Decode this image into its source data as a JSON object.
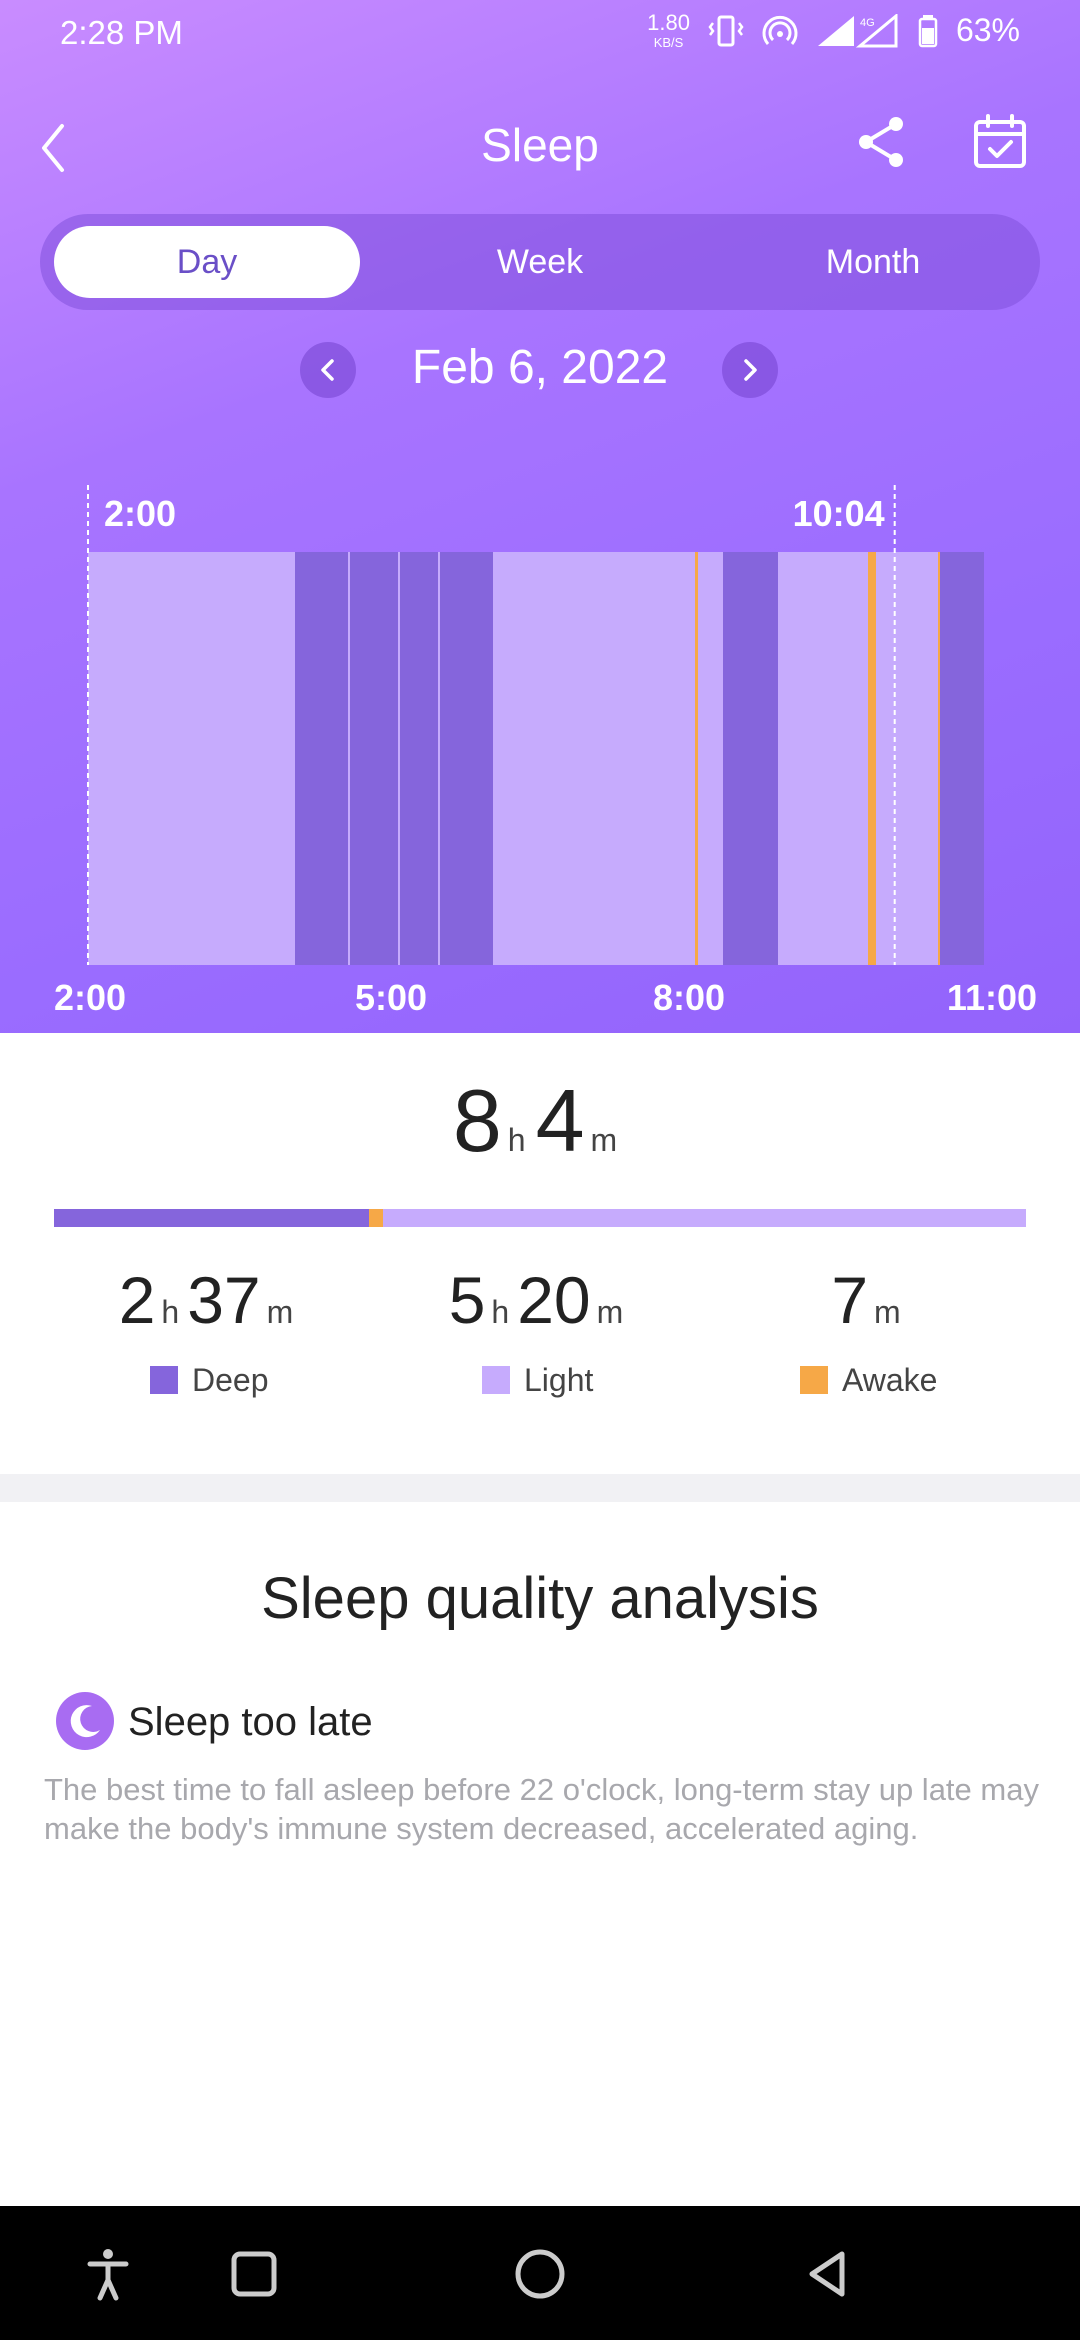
{
  "status_bar": {
    "time": "2:28 PM",
    "net_speed": "1.80",
    "net_unit": "KB/S",
    "network": "4G",
    "battery": "63%"
  },
  "header": {
    "title": "Sleep",
    "icons": [
      "back-arrow-icon",
      "share-icon",
      "calendar-check-icon"
    ]
  },
  "tabs": [
    {
      "label": "Day",
      "active": true
    },
    {
      "label": "Week",
      "active": false
    },
    {
      "label": "Month",
      "active": false
    }
  ],
  "date": "Feb 6, 2022",
  "chart_data": {
    "type": "bar",
    "title": "",
    "x_range": [
      "2:00",
      "11:00"
    ],
    "x_ticks": [
      "2:00",
      "5:00",
      "8:00",
      "11:00"
    ],
    "sleep_start_label": "2:00",
    "sleep_end_label": "10:04",
    "sleep_start_hour": 2.0,
    "sleep_end_hour": 10.067,
    "stage_colors": {
      "deep": "#8565dc",
      "light": "#c6abfd",
      "awake": "#f6a847"
    },
    "segments": [
      {
        "stage": "light",
        "start": 2.0,
        "end": 4.07
      },
      {
        "stage": "deep",
        "start": 4.07,
        "end": 4.6
      },
      {
        "stage": "light",
        "start": 4.6,
        "end": 4.62
      },
      {
        "stage": "deep",
        "start": 4.62,
        "end": 5.1
      },
      {
        "stage": "light",
        "start": 5.1,
        "end": 5.12
      },
      {
        "stage": "deep",
        "start": 5.12,
        "end": 5.5
      },
      {
        "stage": "light",
        "start": 5.5,
        "end": 5.52
      },
      {
        "stage": "deep",
        "start": 5.52,
        "end": 6.05
      },
      {
        "stage": "light",
        "start": 6.05,
        "end": 8.07
      },
      {
        "stage": "awake",
        "start": 8.07,
        "end": 8.1
      },
      {
        "stage": "light",
        "start": 8.1,
        "end": 8.35
      },
      {
        "stage": "deep",
        "start": 8.35,
        "end": 8.9
      },
      {
        "stage": "light",
        "start": 8.9,
        "end": 9.8
      },
      {
        "stage": "awake",
        "start": 9.8,
        "end": 9.88
      },
      {
        "stage": "light",
        "start": 9.88,
        "end": 10.5
      },
      {
        "stage": "awake",
        "start": 10.5,
        "end": 10.52
      },
      {
        "stage": "deep",
        "start": 10.52,
        "end": 10.96
      }
    ]
  },
  "summary": {
    "total_h": "8",
    "total_m": "4",
    "hour_unit": "h",
    "minute_unit": "m",
    "stages": [
      {
        "key": "deep",
        "label": "Deep",
        "h": "2",
        "m": "37",
        "minutes": 157,
        "color": "#8565dc"
      },
      {
        "key": "light",
        "label": "Light",
        "h": "5",
        "m": "20",
        "minutes": 320,
        "color": "#c6abfd"
      },
      {
        "key": "awake",
        "label": "Awake",
        "h": "",
        "m": "7",
        "minutes": 7,
        "color": "#f6a847"
      }
    ]
  },
  "analysis": {
    "title": "Sleep quality analysis",
    "items": [
      {
        "icon": "moon-sleep-icon",
        "title": "Sleep too late",
        "description": "The best time to fall asleep before 22 o'clock, long-term stay up late may make the body's immune system decreased, accelerated aging."
      }
    ]
  },
  "nav_bar": {
    "icons": [
      "accessibility-icon",
      "recents-square-icon",
      "home-circle-icon",
      "back-triangle-icon"
    ]
  }
}
